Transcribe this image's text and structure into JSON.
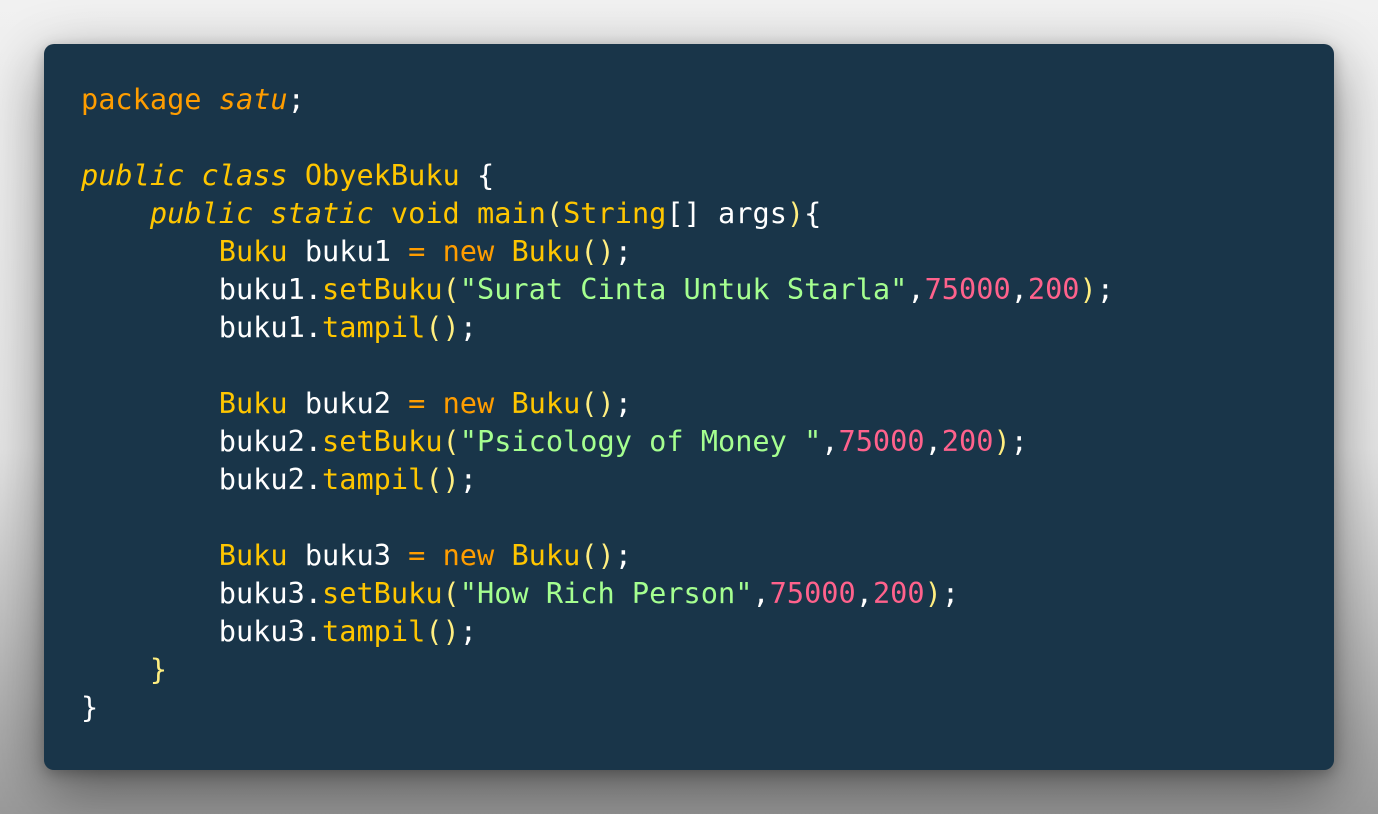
{
  "colors": {
    "background": "#193549",
    "keyword": "#ff9d00",
    "type": "#ffc600",
    "string": "#a5ff90",
    "number": "#ff628c",
    "plain": "#ffffff"
  },
  "code": {
    "line1": {
      "kw": "package",
      "name": "satu",
      "end": ";"
    },
    "line3": {
      "mod1": "public",
      "mod2": "class",
      "cls": "ObyekBuku",
      "brace": "{"
    },
    "line4": {
      "mod1": "public",
      "mod2": "static",
      "ret": "void",
      "fn": "main",
      "open": "(",
      "type": "String",
      "arr": "[]",
      "arg": "args",
      "close": ")",
      "brace": "{"
    },
    "block1": {
      "decl_type": "Buku",
      "var": "buku1",
      "eq": "=",
      "new": "new",
      "ctor": "Buku",
      "ctor_args": "()",
      "semi": ";",
      "call_obj": "buku1.",
      "call_fn": "setBuku",
      "call_open": "(",
      "title": "\"Surat Cinta Untuk Starla\"",
      "price": "75000",
      "pages": "200",
      "call_close": ")",
      "show_obj": "buku1.",
      "show_fn": "tampil",
      "show_args": "()"
    },
    "block2": {
      "decl_type": "Buku",
      "var": "buku2",
      "eq": "=",
      "new": "new",
      "ctor": "Buku",
      "ctor_args": "()",
      "semi": ";",
      "call_obj": "buku2.",
      "call_fn": "setBuku",
      "call_open": "(",
      "title": "\"Psicology of Money \"",
      "price": "75000",
      "pages": "200",
      "call_close": ")",
      "show_obj": "buku2.",
      "show_fn": "tampil",
      "show_args": "()"
    },
    "block3": {
      "decl_type": "Buku",
      "var": "buku3",
      "eq": "=",
      "new": "new",
      "ctor": "Buku",
      "ctor_args": "()",
      "semi": ";",
      "call_obj": "buku3.",
      "call_fn": "setBuku",
      "call_open": "(",
      "title": "\"How Rich Person\"",
      "price": "75000",
      "pages": "200",
      "call_close": ")",
      "show_obj": "buku3.",
      "show_fn": "tampil",
      "show_args": "()"
    },
    "close_method": "}",
    "close_class": "}"
  }
}
